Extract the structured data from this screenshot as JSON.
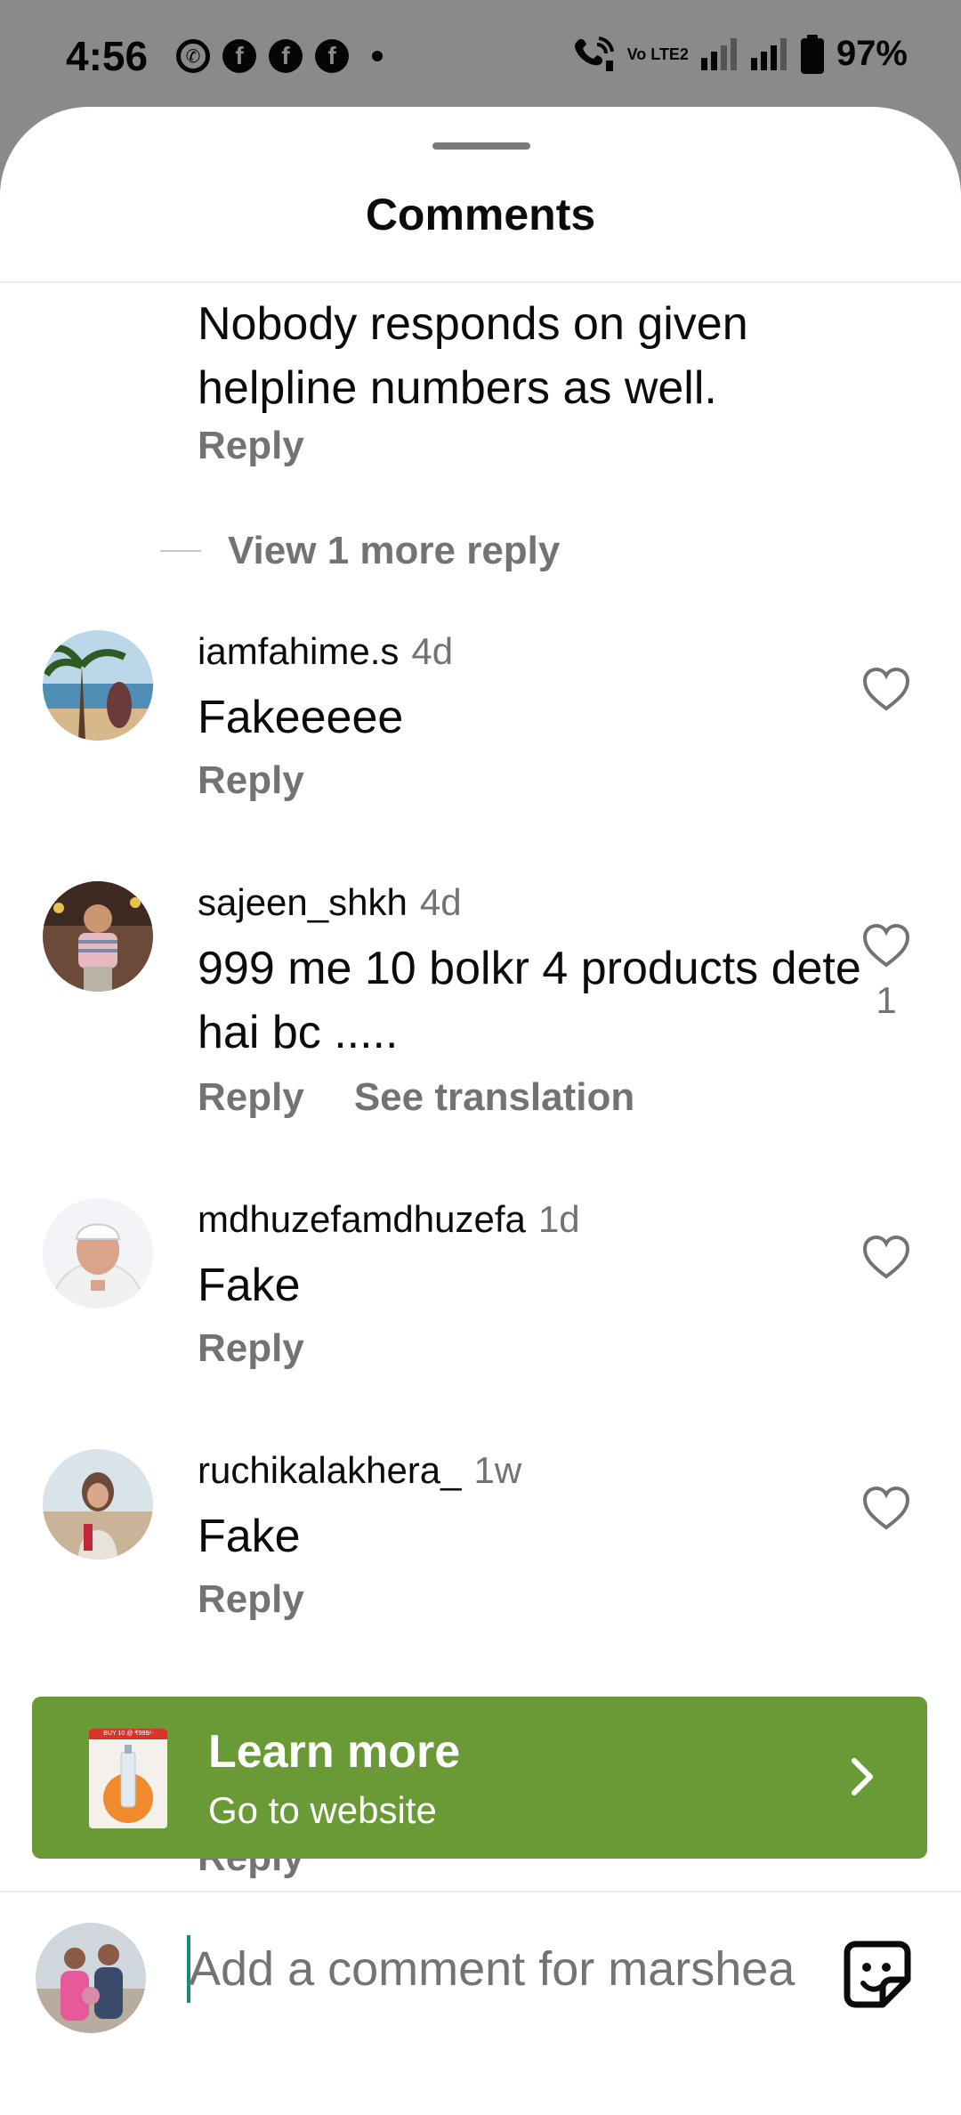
{
  "status_bar": {
    "time": "4:56",
    "battery": "97%",
    "network_label": "Vo LTE2",
    "notification_icons": [
      "whatsapp-icon",
      "facebook-icon",
      "facebook-icon",
      "facebook-icon"
    ]
  },
  "sheet": {
    "title": "Comments"
  },
  "partial_comment": {
    "text": "Nobody responds on given helpline numbers as well.",
    "reply_label": "Reply"
  },
  "view_more": {
    "label": "View 1 more reply"
  },
  "comments": [
    {
      "username": "iamfahime.s",
      "time": "4d",
      "text": "Fakeeeee",
      "reply_label": "Reply",
      "likes": ""
    },
    {
      "username": "sajeen_shkh",
      "time": "4d",
      "text": "999 me 10 bolkr 4 products dete hai bc .....",
      "reply_label": "Reply",
      "translate_label": "See translation",
      "likes": "1"
    },
    {
      "username": "mdhuzefamdhuzefa",
      "time": "1d",
      "text": "Fake",
      "reply_label": "Reply",
      "likes": ""
    },
    {
      "username": "ruchikalakhera_",
      "time": "1w",
      "text": "Fake",
      "reply_label": "Reply",
      "likes": ""
    }
  ],
  "ad_banner": {
    "title": "Learn more",
    "subtitle": "Go to website",
    "thumb_badge": "BUY 10 @ ₹999/-",
    "color": "#6a9a35"
  },
  "hidden_reply_label": "Reply",
  "comment_bar": {
    "placeholder": "Add a comment for marshea",
    "sticker_icon": "sticker-icon"
  },
  "colors": {
    "accent_caret": "#1b8a74",
    "secondary_text": "#737373"
  }
}
